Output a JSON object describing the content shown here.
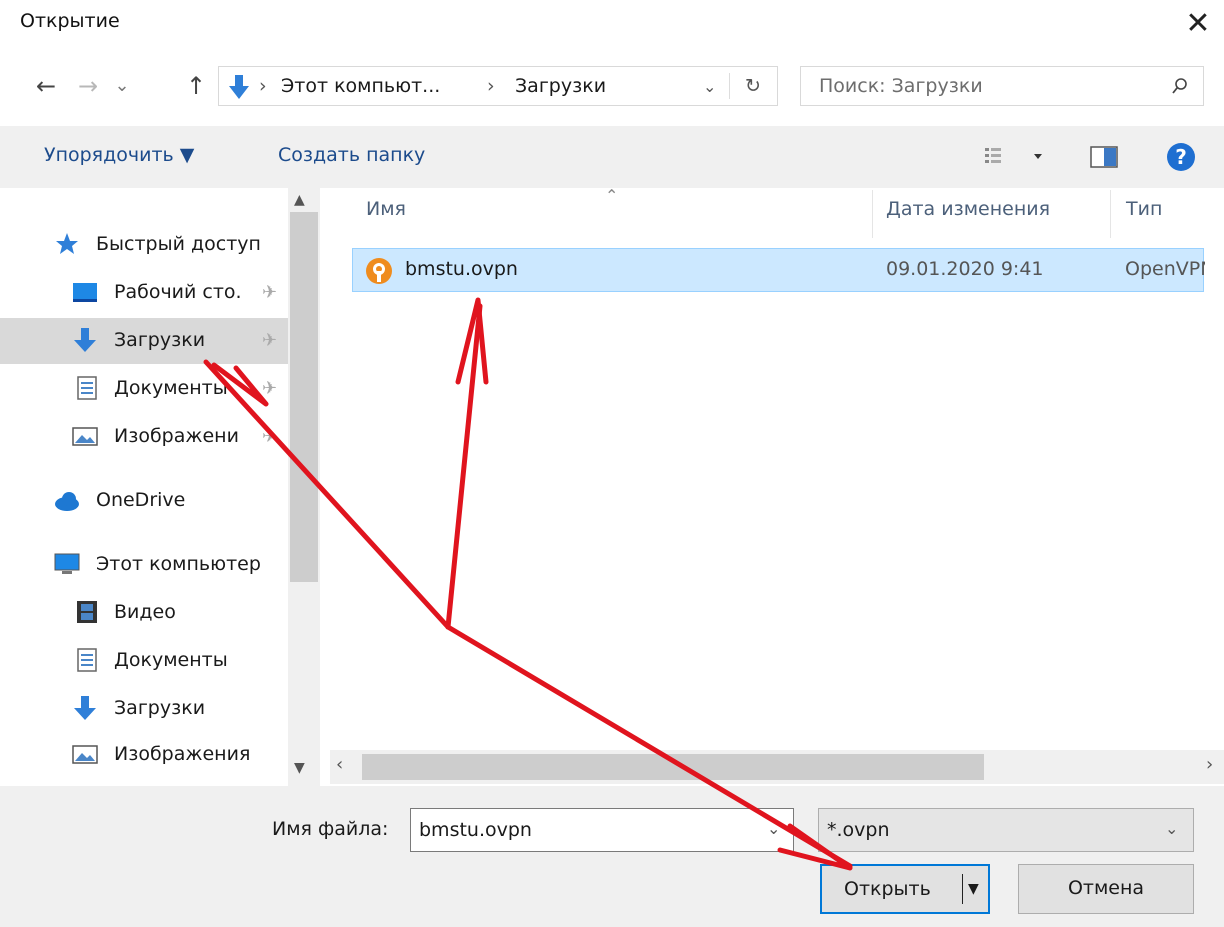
{
  "window": {
    "title": "Открытие"
  },
  "nav": {
    "back_icon": "←",
    "forward_icon": "→",
    "recent_icon": "⌄",
    "up_icon": "↑",
    "breadcrumb": [
      "Этот компьют...",
      "Загрузки"
    ],
    "refresh_icon": "↻"
  },
  "search": {
    "placeholder": "Поиск: Загрузки"
  },
  "toolbar": {
    "organize_label": "Упорядочить ▼",
    "new_folder_label": "Создать папку"
  },
  "sidebar": {
    "items": [
      {
        "label": "Быстрый доступ",
        "icon": "star-icon"
      },
      {
        "label": "Рабочий сто.",
        "icon": "desktop-icon",
        "pinned": true
      },
      {
        "label": "Загрузки",
        "icon": "download-arrow-icon",
        "pinned": true,
        "selected": true
      },
      {
        "label": "Документы",
        "icon": "document-icon",
        "pinned": true
      },
      {
        "label": "Изображени",
        "icon": "image-icon",
        "pinned": true
      },
      {
        "label": "OneDrive",
        "icon": "cloud-icon"
      },
      {
        "label": "Этот компьютер",
        "icon": "computer-icon"
      },
      {
        "label": "Видео",
        "icon": "video-icon"
      },
      {
        "label": "Документы",
        "icon": "document-icon"
      },
      {
        "label": "Загрузки",
        "icon": "download-arrow-icon"
      },
      {
        "label": "Изображения",
        "icon": "image-icon"
      }
    ]
  },
  "filelist": {
    "columns": [
      "Имя",
      "Дата изменения",
      "Тип"
    ],
    "rows": [
      {
        "name": "bmstu.ovpn",
        "date": "09.01.2020 9:41",
        "type": "OpenVPN"
      }
    ]
  },
  "footer": {
    "filename_label": "Имя файла:",
    "filename_value": "bmstu.ovpn",
    "filetype_value": "*.ovpn",
    "open_label": "Открыть",
    "cancel_label": "Отмена"
  },
  "colors": {
    "accent": "#0078d7",
    "selection": "#cce8ff",
    "annotation": "#e0141e"
  }
}
